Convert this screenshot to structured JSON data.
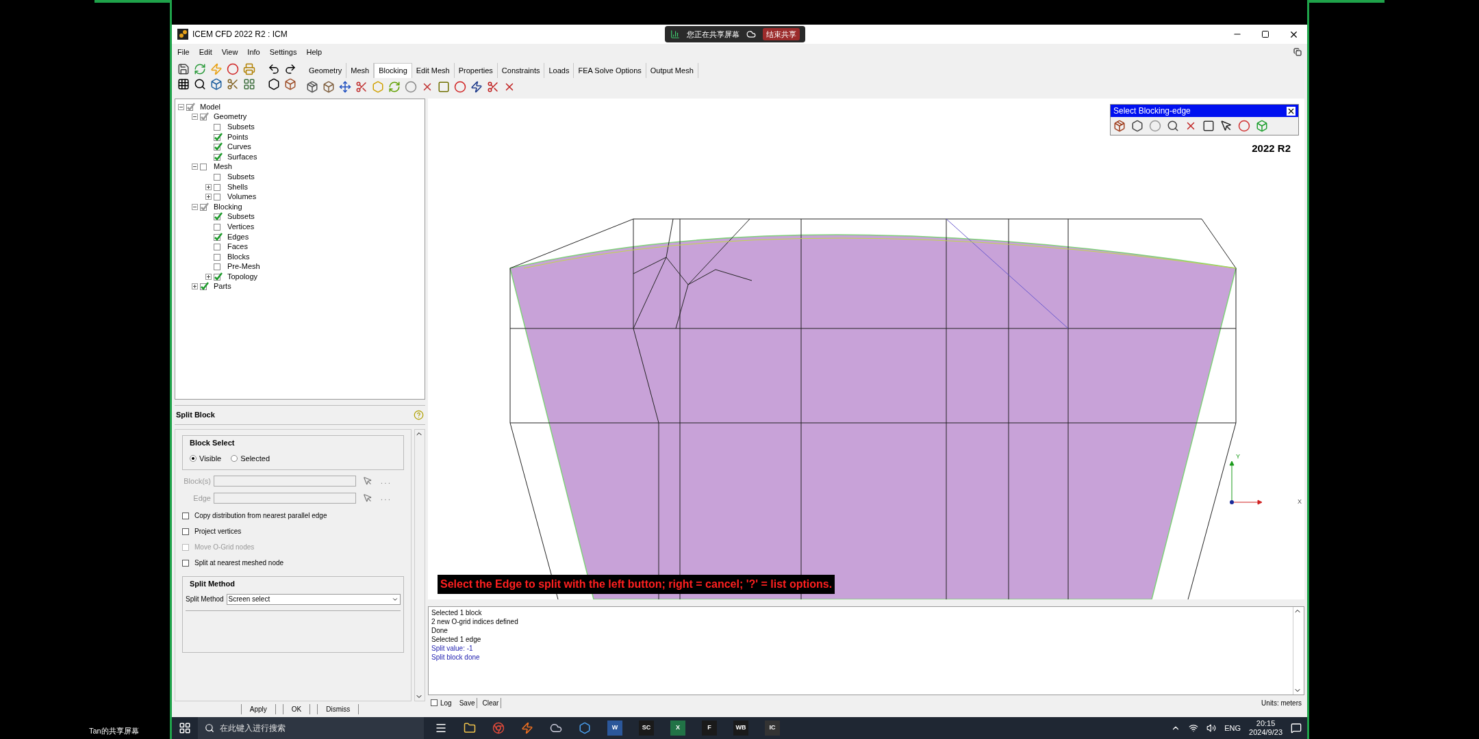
{
  "screen_share": {
    "caption": "Tan的共享屏幕",
    "status": "您正在共享屏幕",
    "stop_button": "结束共享"
  },
  "window": {
    "title": "ICEM CFD 2022 R2 : ICM"
  },
  "menu": [
    "File",
    "Edit",
    "View",
    "Info",
    "Settings",
    "Help"
  ],
  "tabs": [
    {
      "label": "Geometry",
      "selected": false
    },
    {
      "label": "Mesh",
      "selected": false
    },
    {
      "label": "Blocking",
      "selected": true
    },
    {
      "label": "Edit Mesh",
      "selected": false
    },
    {
      "label": "Properties",
      "selected": false
    },
    {
      "label": "Constraints",
      "selected": false
    },
    {
      "label": "Loads",
      "selected": false
    },
    {
      "label": "FEA Solve Options",
      "selected": false
    },
    {
      "label": "Output Mesh",
      "selected": false
    }
  ],
  "tree": [
    {
      "label": "Model",
      "checked": true,
      "partial": true,
      "expanded": true,
      "children": [
        {
          "label": "Geometry",
          "checked": true,
          "partial": true,
          "expanded": true,
          "children": [
            {
              "label": "Subsets",
              "checked": false
            },
            {
              "label": "Points",
              "checked": true,
              "partial": false
            },
            {
              "label": "Curves",
              "checked": true,
              "partial": false
            },
            {
              "label": "Surfaces",
              "checked": true,
              "partial": false
            }
          ]
        },
        {
          "label": "Mesh",
          "checked": false,
          "expanded": true,
          "children": [
            {
              "label": "Subsets",
              "checked": false
            },
            {
              "label": "Shells",
              "checked": false,
              "expanded": false
            },
            {
              "label": "Volumes",
              "checked": false,
              "expanded": false
            }
          ]
        },
        {
          "label": "Blocking",
          "checked": true,
          "partial": true,
          "expanded": true,
          "children": [
            {
              "label": "Subsets",
              "checked": true,
              "partial": false
            },
            {
              "label": "Vertices",
              "checked": false
            },
            {
              "label": "Edges",
              "checked": true,
              "partial": false
            },
            {
              "label": "Faces",
              "checked": false
            },
            {
              "label": "Blocks",
              "checked": false
            },
            {
              "label": "Pre-Mesh",
              "checked": false
            },
            {
              "label": "Topology",
              "checked": true,
              "partial": false,
              "expanded": false
            }
          ]
        },
        {
          "label": "Parts",
          "checked": true,
          "partial": false,
          "expanded": false
        }
      ]
    }
  ],
  "split_block": {
    "title": "Split Block",
    "block_select": {
      "title": "Block Select",
      "options": [
        {
          "label": "Visible",
          "selected": true
        },
        {
          "label": "Selected",
          "selected": false
        }
      ]
    },
    "fields": [
      {
        "label": "Block(s)",
        "more": ". . ."
      },
      {
        "label": "Edge",
        "more": ". . ."
      }
    ],
    "checkboxes": [
      {
        "label": "Copy distribution from nearest parallel edge",
        "checked": false,
        "disabled": false
      },
      {
        "label": "Project vertices",
        "checked": false,
        "disabled": false
      },
      {
        "label": "Move O-Grid nodes",
        "checked": false,
        "disabled": true
      },
      {
        "label": "Split at nearest meshed node",
        "checked": false,
        "disabled": false
      }
    ],
    "split_method": {
      "title": "Split Method",
      "label": "Split Method",
      "value": "Screen select"
    },
    "buttons": [
      "Apply",
      "OK",
      "Dismiss"
    ]
  },
  "select_toolbar": {
    "title": "Select Blocking-edge"
  },
  "viewport": {
    "version": "2022 R2",
    "prompt": "Select the Edge to split with the left button; right = cancel; '?' = list options.",
    "axis_labels": [
      "Y",
      "X"
    ]
  },
  "messages": [
    {
      "text": "Selected 1 block",
      "kind": "info"
    },
    {
      "text": "2 new O-grid indices defined",
      "kind": "info"
    },
    {
      "text": "Done",
      "kind": "info"
    },
    {
      "text": "Selected 1 edge",
      "kind": "info"
    },
    {
      "text": "Split value: -1",
      "kind": "result"
    },
    {
      "text": "Split block done",
      "kind": "result"
    }
  ],
  "message_bar": {
    "log": {
      "label": "Log",
      "checked": false
    },
    "buttons": [
      "Save",
      "Clear"
    ],
    "units": "Units: meters"
  },
  "taskbar": {
    "search_placeholder": "在此键入进行搜索",
    "apps": [
      {
        "label": "W",
        "color": "#2b579a"
      },
      {
        "label": "SC",
        "color": "#1a1a1a"
      },
      {
        "label": "X",
        "color": "#217346"
      },
      {
        "label": "F",
        "color": "#1a1a1a"
      },
      {
        "label": "WB",
        "color": "#1a1a1a"
      },
      {
        "label": "IC",
        "color": "#333333"
      }
    ],
    "language": "ENG",
    "time": "20:15",
    "date": "2024/9/23"
  }
}
